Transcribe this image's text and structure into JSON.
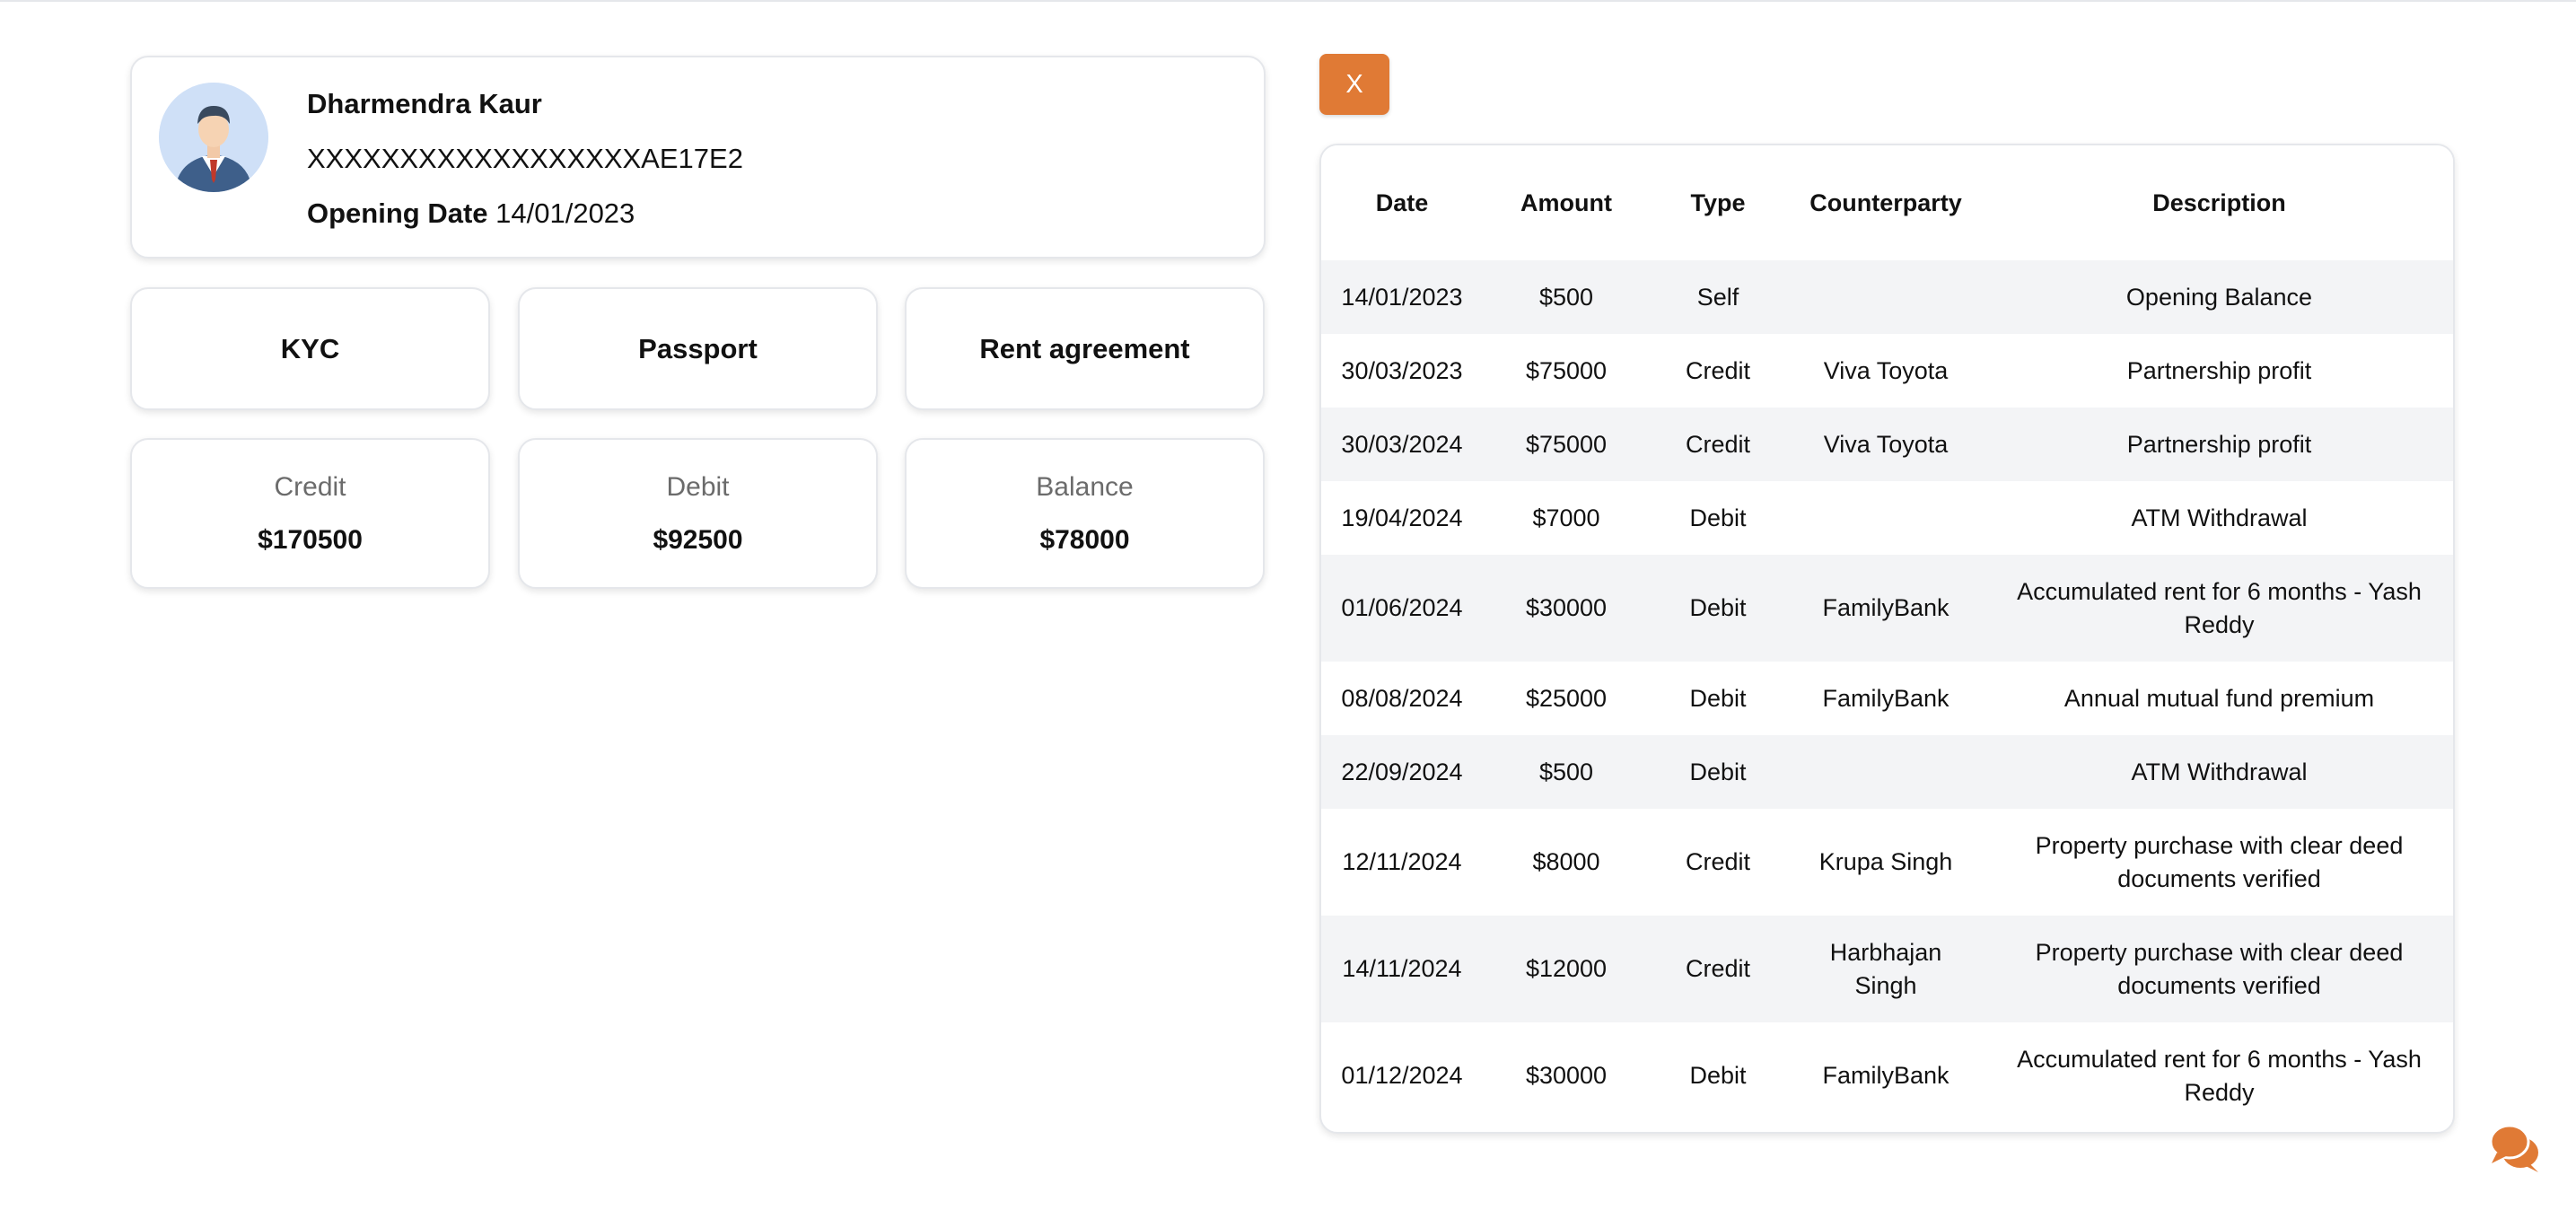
{
  "profile": {
    "name": "Dharmendra Kaur",
    "account_number": "XXXXXXXXXXXXXXXXXXAE17E2",
    "opening_date_label": "Opening Date",
    "opening_date": "14/01/2023",
    "avatar_icon": "businessman-avatar-icon"
  },
  "documents": [
    "KYC",
    "Passport",
    "Rent agreement"
  ],
  "summary": [
    {
      "label": "Credit",
      "value": "$170500"
    },
    {
      "label": "Debit",
      "value": "$92500"
    },
    {
      "label": "Balance",
      "value": "$78000"
    }
  ],
  "close_button": {
    "label": "X"
  },
  "table": {
    "headers": [
      "Date",
      "Amount",
      "Type",
      "Counterparty",
      "Description"
    ],
    "rows": [
      [
        "14/01/2023",
        "$500",
        "Self",
        "",
        "Opening Balance"
      ],
      [
        "30/03/2023",
        "$75000",
        "Credit",
        "Viva Toyota",
        "Partnership profit"
      ],
      [
        "30/03/2024",
        "$75000",
        "Credit",
        "Viva Toyota",
        "Partnership profit"
      ],
      [
        "19/04/2024",
        "$7000",
        "Debit",
        "",
        "ATM Withdrawal"
      ],
      [
        "01/06/2024",
        "$30000",
        "Debit",
        "FamilyBank",
        "Accumulated rent for 6 months - Yash Reddy"
      ],
      [
        "08/08/2024",
        "$25000",
        "Debit",
        "FamilyBank",
        "Annual mutual fund premium"
      ],
      [
        "22/09/2024",
        "$500",
        "Debit",
        "",
        "ATM Withdrawal"
      ],
      [
        "12/11/2024",
        "$8000",
        "Credit",
        "Krupa Singh",
        "Property purchase with clear deed documents verified"
      ],
      [
        "14/11/2024",
        "$12000",
        "Credit",
        "Harbhajan Singh",
        "Property purchase with clear deed documents verified"
      ],
      [
        "01/12/2024",
        "$30000",
        "Debit",
        "FamilyBank",
        "Accumulated rent for 6 months - Yash Reddy"
      ]
    ]
  },
  "colors": {
    "accent": "#e07a35",
    "row_alt": "#f3f4f6",
    "border": "#e5e7eb"
  },
  "chat_icon": "chat-bubbles-icon"
}
